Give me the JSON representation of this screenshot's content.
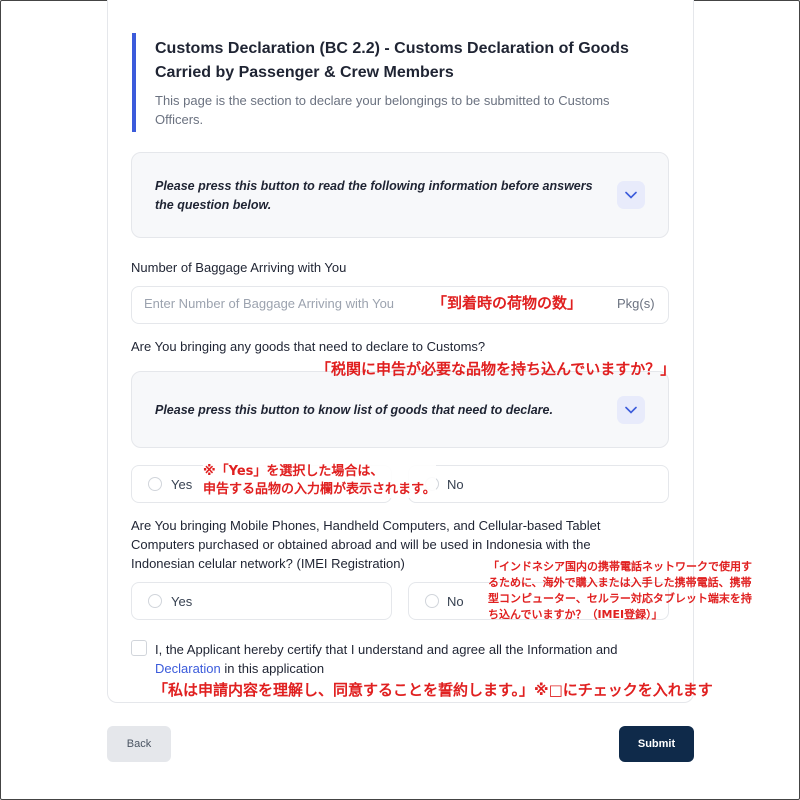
{
  "form": {
    "title": "Customs Declaration (BC 2.2) - Customs Declaration of Goods Carried by Passenger & Crew Members",
    "subtitle": "This page is the section to declare your belongings to be submitted to Customs Officers.",
    "info_box_1": "Please press this button to read the following information before answers the question below.",
    "baggage_label": "Number of Baggage Arriving with You",
    "baggage_placeholder": "Enter Number of Baggage Arriving with You",
    "baggage_suffix": "Pkg(s)",
    "goods_question": "Are You bringing any goods that need to declare to Customs?",
    "info_box_2": "Please press this button to know list of goods that need to declare.",
    "goods_yes": "Yes",
    "goods_no": "No",
    "imei_question": "Are You bringing Mobile Phones, Handheld Computers, and Cellular-based Tablet Computers purchased or obtained abroad and will be used in Indonesia with the Indonesian celular network? (IMEI Registration)",
    "imei_yes": "Yes",
    "imei_no": "No",
    "certify_text": "I, the Applicant hereby certify that I understand and agree all the Information and",
    "certify_link": "Declaration",
    "certify_suffix": " in this application"
  },
  "buttons": {
    "back": "Back",
    "submit": "Submit"
  },
  "annotations": {
    "baggage": "「到着時の荷物の数」",
    "goods": "「税関に申告が必要な品物を持ち込んでいますか？」",
    "yes_note_1": "※「Yes」を選択した場合は、",
    "yes_note_2": "申告する品物の入力欄が表示されます。",
    "imei_1": "「インドネシア国内の携帯電話ネットワークで使用す",
    "imei_2": "るために、海外で購入または入手した携帯電話、携帯",
    "imei_3": "型コンピューター、セルラー対応タブレット端末を持",
    "imei_4": "ち込んでいますか？（IMEI登録）」",
    "certify": "「私は申請内容を理解し、同意することを誓約します。」※□にチェックを入れます"
  },
  "colors": {
    "accent": "#3b5bdb",
    "submit_bg": "#0f2a4a",
    "annotation": "#e02020"
  }
}
